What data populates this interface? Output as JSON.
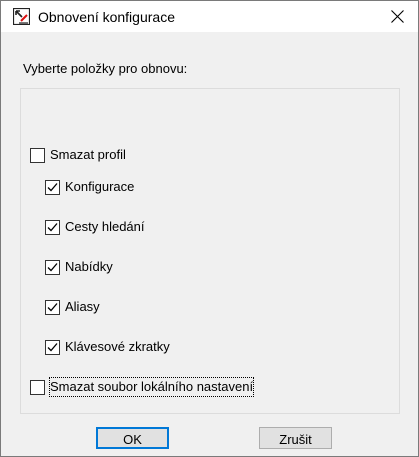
{
  "window": {
    "title": "Obnovení konfigurace",
    "close_glyph": "✕"
  },
  "prompt": "Vyberte položky pro obnovu:",
  "options": [
    {
      "label": "Smazat profil",
      "checked": false
    },
    {
      "label": "Konfigurace",
      "checked": true
    },
    {
      "label": "Cesty hledání",
      "checked": true
    },
    {
      "label": "Nabídky",
      "checked": true
    },
    {
      "label": "Aliasy",
      "checked": true
    },
    {
      "label": "Klávesové zkratky",
      "checked": true
    },
    {
      "label": "Smazat soubor lokálního nastavení",
      "checked": false
    }
  ],
  "buttons": {
    "ok": "OK",
    "cancel": "Zrušit"
  },
  "colors": {
    "dialog_bg": "#f0f0f0",
    "accent": "#0078d7",
    "button_bg": "#e1e1e1"
  }
}
